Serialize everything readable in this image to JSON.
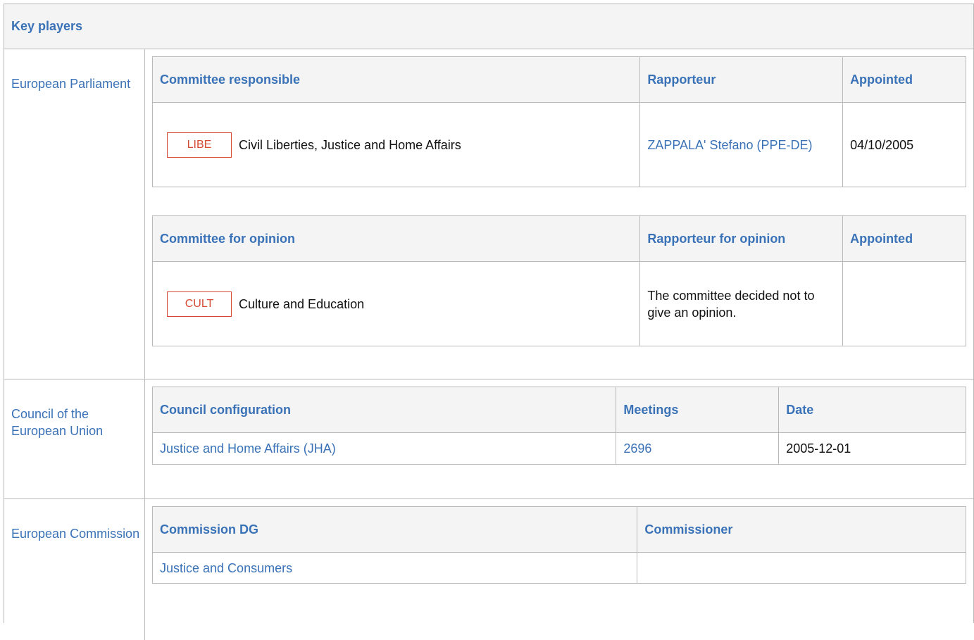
{
  "header": {
    "title": "Key players"
  },
  "parliament": {
    "label": "European Parliament",
    "responsible": {
      "headers": [
        "Committee responsible",
        "Rapporteur",
        "Appointed"
      ],
      "row": {
        "code": "LIBE",
        "name": "Civil Liberties, Justice and Home Affairs",
        "rapporteur": "ZAPPALA' Stefano (PPE-DE)",
        "appointed": "04/10/2005"
      }
    },
    "opinion": {
      "headers": [
        "Committee for opinion",
        "Rapporteur for opinion",
        "Appointed"
      ],
      "row": {
        "code": "CULT",
        "name": "Culture and Education",
        "rapporteur": "The committee decided not to give an opinion.",
        "appointed": ""
      }
    }
  },
  "council": {
    "label": "Council of the European Union",
    "headers": [
      "Council configuration",
      "Meetings",
      "Date"
    ],
    "row": {
      "configuration": "Justice and Home Affairs (JHA)",
      "meeting": "2696",
      "date": "2005-12-01"
    }
  },
  "commission": {
    "label": "European Commission",
    "headers": [
      "Commission DG",
      "Commissioner"
    ],
    "row": {
      "dg": "Justice and Consumers",
      "commissioner": ""
    }
  },
  "colors": {
    "link": "#3a72b7",
    "badge": "#d54a33",
    "border": "#b9b9b9",
    "header_bg": "#f4f4f4"
  }
}
